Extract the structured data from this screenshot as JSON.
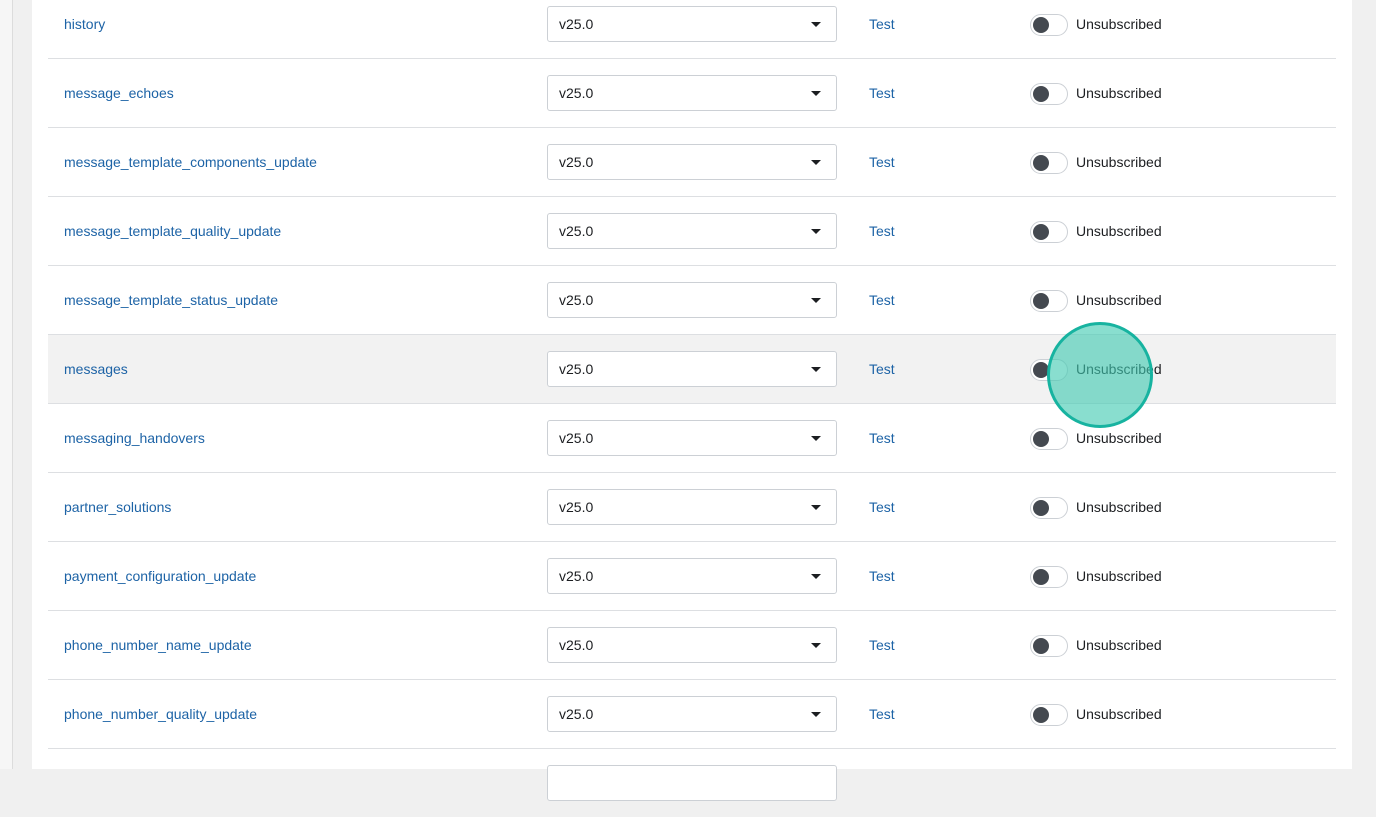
{
  "webhook_fields": [
    {
      "name": "history",
      "version": "v25.0",
      "test_label": "Test",
      "status": "Unsubscribed",
      "subscribed": false
    },
    {
      "name": "message_echoes",
      "version": "v25.0",
      "test_label": "Test",
      "status": "Unsubscribed",
      "subscribed": false
    },
    {
      "name": "message_template_components_update",
      "version": "v25.0",
      "test_label": "Test",
      "status": "Unsubscribed",
      "subscribed": false
    },
    {
      "name": "message_template_quality_update",
      "version": "v25.0",
      "test_label": "Test",
      "status": "Unsubscribed",
      "subscribed": false
    },
    {
      "name": "message_template_status_update",
      "version": "v25.0",
      "test_label": "Test",
      "status": "Unsubscribed",
      "subscribed": false
    },
    {
      "name": "messages",
      "version": "v25.0",
      "test_label": "Test",
      "status": "Unsubscribed",
      "subscribed": false,
      "hovered": true
    },
    {
      "name": "messaging_handovers",
      "version": "v25.0",
      "test_label": "Test",
      "status": "Unsubscribed",
      "subscribed": false
    },
    {
      "name": "partner_solutions",
      "version": "v25.0",
      "test_label": "Test",
      "status": "Unsubscribed",
      "subscribed": false
    },
    {
      "name": "payment_configuration_update",
      "version": "v25.0",
      "test_label": "Test",
      "status": "Unsubscribed",
      "subscribed": false
    },
    {
      "name": "phone_number_name_update",
      "version": "v25.0",
      "test_label": "Test",
      "status": "Unsubscribed",
      "subscribed": false
    },
    {
      "name": "phone_number_quality_update",
      "version": "v25.0",
      "test_label": "Test",
      "status": "Unsubscribed",
      "subscribed": false
    },
    {
      "name": "",
      "version": "",
      "test_label": "",
      "status": "",
      "subscribed": false,
      "partial": true
    }
  ],
  "icons": {
    "dropdown": "caret-down-icon",
    "toggle": "toggle-switch-icon"
  },
  "colors": {
    "link": "#1d63a6",
    "highlight_row": "#f2f2f2",
    "toggle_off_knob": "#444950",
    "click_indicator": "#40c9b2"
  }
}
